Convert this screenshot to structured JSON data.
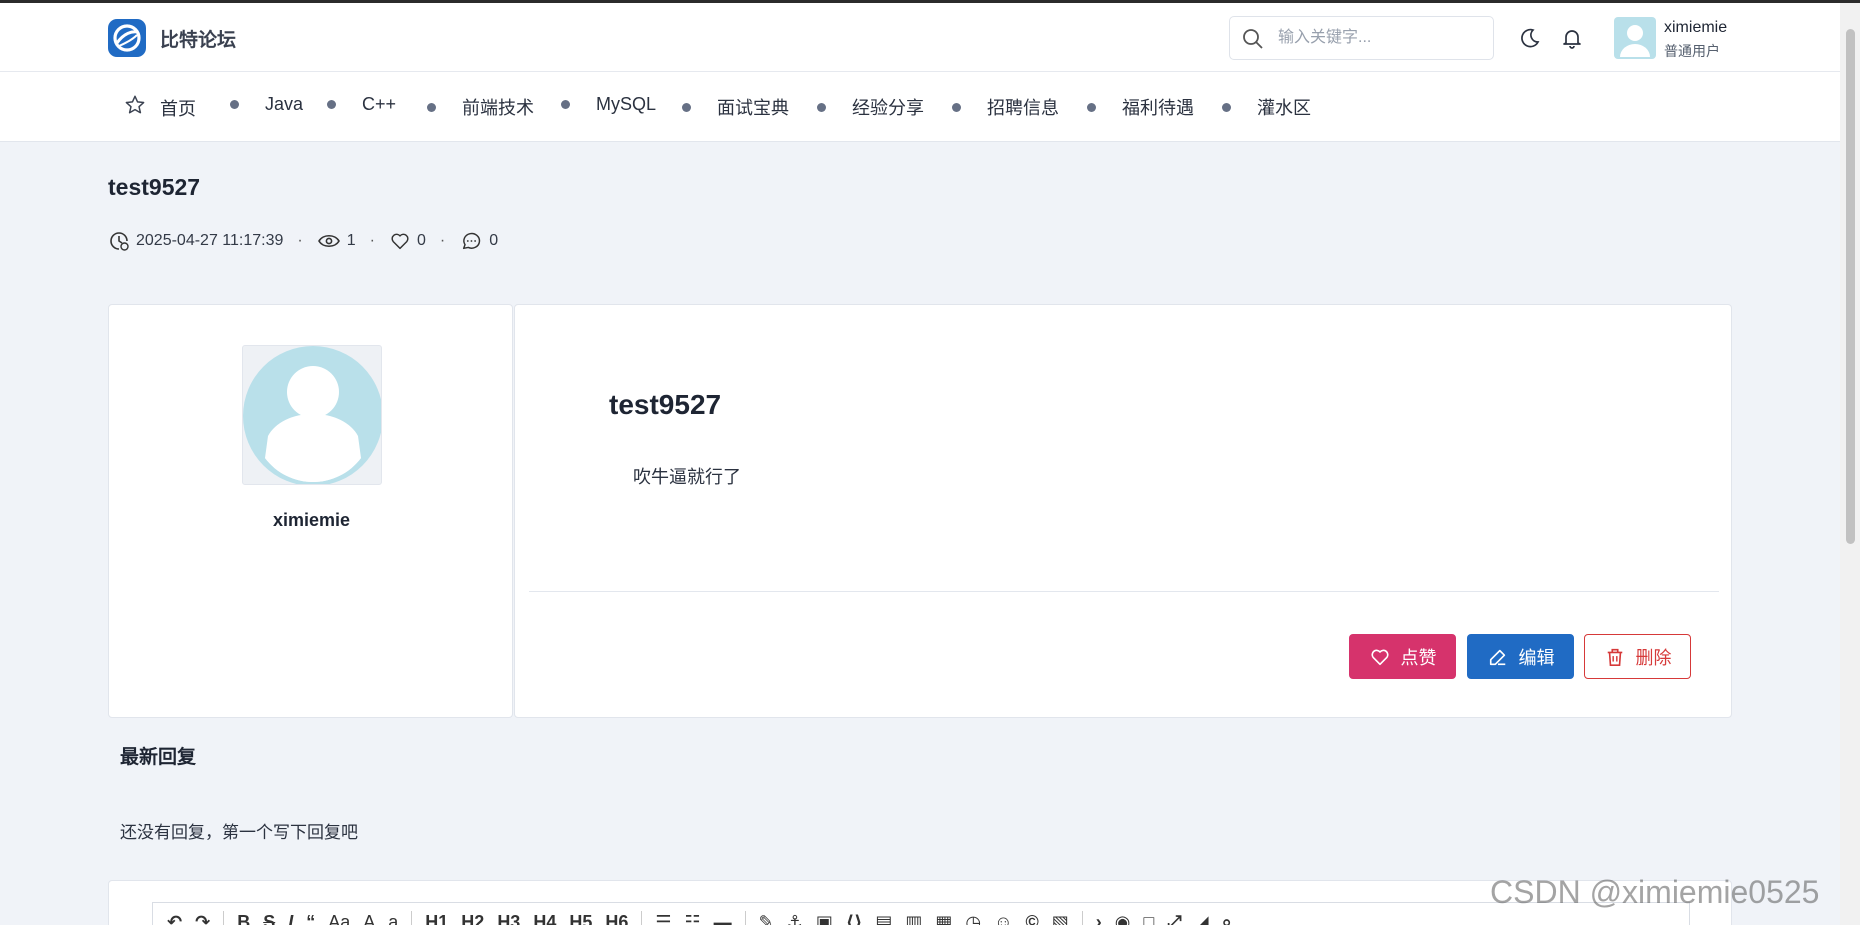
{
  "header": {
    "brand": "比特论坛",
    "search_placeholder": "输入关键字...",
    "user": {
      "name": "ximiemie",
      "role": "普通用户"
    }
  },
  "nav": {
    "items": [
      {
        "label": "首页",
        "icon": "star-icon"
      },
      {
        "label": "Java"
      },
      {
        "label": "C++"
      },
      {
        "label": "前端技术"
      },
      {
        "label": "MySQL"
      },
      {
        "label": "面试宝典"
      },
      {
        "label": "经验分享"
      },
      {
        "label": "招聘信息"
      },
      {
        "label": "福利待遇"
      },
      {
        "label": "灌水区"
      }
    ]
  },
  "post": {
    "title": "test9527",
    "datetime": "2025-04-27 11:17:39",
    "views": "1",
    "likes": "0",
    "comments": "0",
    "author": "ximiemie",
    "content_title": "test9527",
    "content_body": "吹牛逼就行了",
    "buttons": {
      "like": "点赞",
      "edit": "编辑",
      "delete": "删除"
    }
  },
  "replies": {
    "title": "最新回复",
    "empty": "还没有回复，第一个写下回复吧"
  },
  "editor": {
    "toolbar": [
      "undo",
      "redo",
      "B",
      "S",
      "I",
      "“",
      "Aa",
      "A",
      "a",
      "H1",
      "H2",
      "H3",
      "H4",
      "H5",
      "H6"
    ]
  },
  "watermark": "CSDN @ximiemie0525",
  "colors": {
    "primary": "#206bc4",
    "like": "#d6336c",
    "danger": "#d63939",
    "background": "#f0f3f8"
  }
}
